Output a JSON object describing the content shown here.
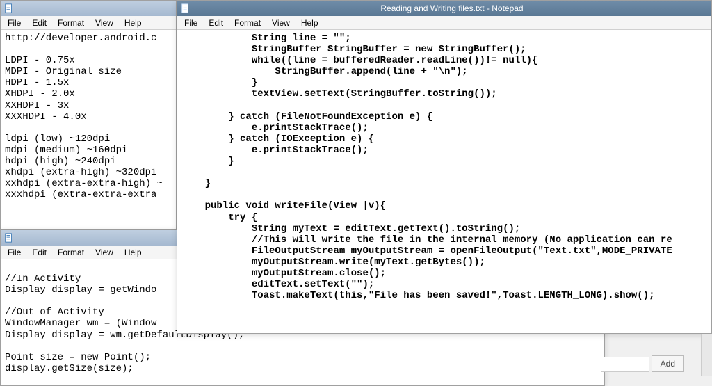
{
  "menus": {
    "file": "File",
    "edit": "Edit",
    "format": "Format",
    "view": "View",
    "help": "Help"
  },
  "window_tl": {
    "title": "",
    "body": "http://developer.android.c\n\nLDPI - 0.75x\nMDPI - Original size\nHDPI - 1.5x\nXHDPI - 2.0x\nXXHDPI - 3x\nXXXHDPI - 4.0x\n\nldpi (low) ~120dpi\nmdpi (medium) ~160dpi\nhdpi (high) ~240dpi\nxhdpi (extra-high) ~320dpi\nxxhdpi (extra-extra-high) ~\nxxxhdpi (extra-extra-extra"
  },
  "window_bl": {
    "title": "",
    "body": "\n//In Activity\nDisplay display = getWindo\n\n//Out of Activity\nWindowManager wm = (Window\nDisplay display = wm.getDefaultDisplay();\n\nPoint size = new Point();\ndisplay.getSize(size);"
  },
  "window_main": {
    "title": "Reading and Writing files.txt - Notepad",
    "body": "            String line = \"\";\n            StringBuffer StringBuffer = new StringBuffer();\n            while((line = bufferedReader.readLine())!= null){\n                StringBuffer.append(line + \"\\n\");\n            }\n            textView.setText(StringBuffer.toString());\n\n        } catch (FileNotFoundException e) {\n            e.printStackTrace();\n        } catch (IOException e) {\n            e.printStackTrace();\n        }\n\n    }\n\n    public void writeFile(View |v){\n        try {\n            String myText = editText.getText().toString();\n            //This will write the file in the internal memory (No application can re\n            FileOutputStream myOutputStream = openFileOutput(\"Text.txt\",MODE_PRIVATE\n            myOutputStream.write(myText.getBytes());\n            myOutputStream.close();\n            editText.setText(\"\");\n            Toast.makeText(this,\"File has been saved!\",Toast.LENGTH_LONG).show();"
  },
  "add_button": "Add"
}
